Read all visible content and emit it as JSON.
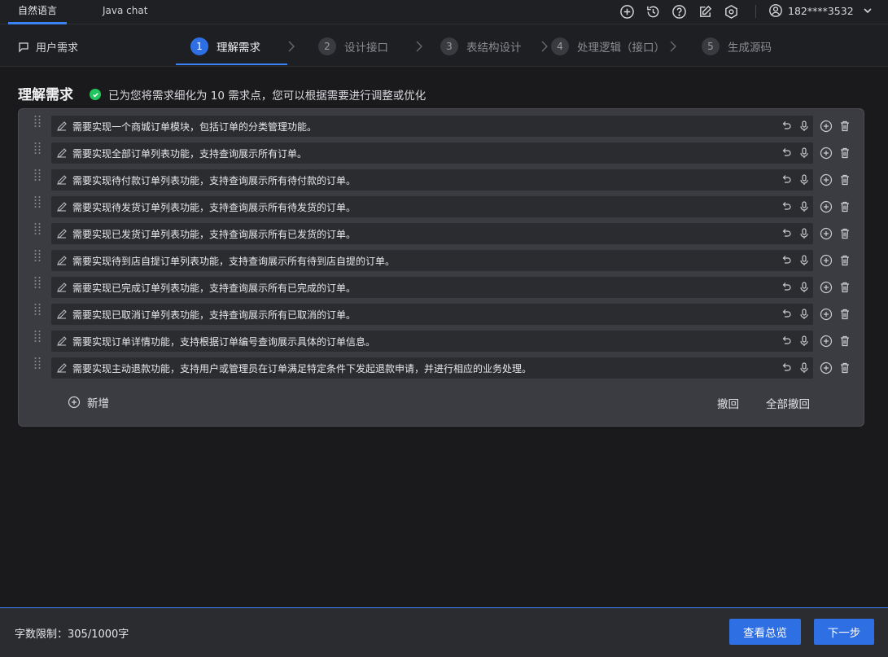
{
  "tabs": [
    {
      "label": "自然语言",
      "active": true
    },
    {
      "label": "Java chat",
      "active": false
    }
  ],
  "top_icons": [
    "plus-circle-icon",
    "history-icon",
    "help-icon",
    "edit-icon",
    "settings-icon"
  ],
  "user": {
    "name": "182****3532"
  },
  "user_requirement_label": "用户需求",
  "steps": [
    {
      "num": "1",
      "label": "理解需求",
      "active": true
    },
    {
      "num": "2",
      "label": "设计接口",
      "active": false
    },
    {
      "num": "3",
      "label": "表结构设计",
      "active": false
    },
    {
      "num": "4",
      "label": "处理逻辑（接口）",
      "active": false
    },
    {
      "num": "5",
      "label": "生成源码",
      "active": false
    }
  ],
  "section": {
    "title": "理解需求",
    "notice": "已为您将需求细化为 10 需求点，您可以根据需要进行调整或优化"
  },
  "requirements": [
    "需要实现一个商城订单模块，包括订单的分类管理功能。",
    "需要实现全部订单列表功能，支持查询展示所有订单。",
    "需要实现待付款订单列表功能，支持查询展示所有待付款的订单。",
    "需要实现待发货订单列表功能，支持查询展示所有待发货的订单。",
    "需要实现已发货订单列表功能，支持查询展示所有已发货的订单。",
    "需要实现待到店自提订单列表功能，支持查询展示所有待到店自提的订单。",
    "需要实现已完成订单列表功能，支持查询展示所有已完成的订单。",
    "需要实现已取消订单列表功能，支持查询展示所有已取消的订单。",
    "需要实现订单详情功能，支持根据订单编号查询展示具体的订单信息。",
    "需要实现主动退款功能，支持用户或管理员在订单满足特定条件下发起退款申请，并进行相应的业务处理。"
  ],
  "actions": {
    "add": "新增",
    "undo": "撤回",
    "undo_all": "全部撤回"
  },
  "footer": {
    "word_limit": "字数限制：305/1000字",
    "overview_btn": "查看总览",
    "next_btn": "下一步"
  },
  "colors": {
    "accent": "#2f6fe4",
    "success": "#22c55e",
    "background": "#1a1a1d"
  }
}
